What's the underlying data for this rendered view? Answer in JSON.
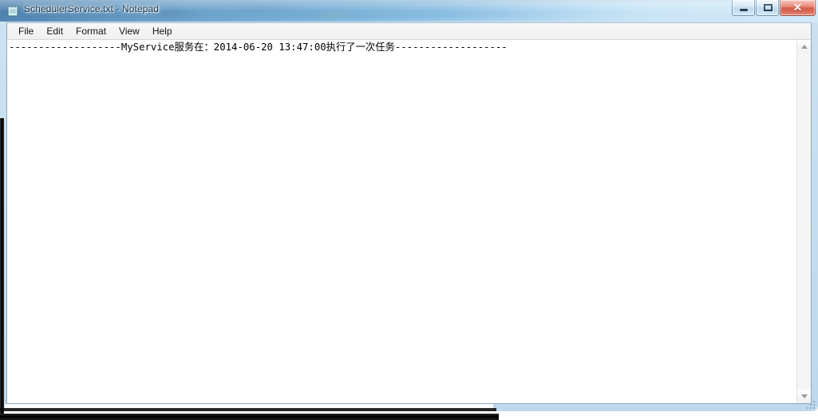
{
  "window": {
    "title": "SchedulerService.txt - Notepad",
    "icon": "notepad-icon",
    "controls": {
      "minimize_label": "–",
      "restore_label": "□",
      "close_label": "✕"
    }
  },
  "menubar": {
    "items": [
      {
        "label": "File"
      },
      {
        "label": "Edit"
      },
      {
        "label": "Format"
      },
      {
        "label": "View"
      },
      {
        "label": "Help"
      }
    ]
  },
  "document": {
    "filename": "SchedulerService.txt",
    "lines": [
      "-------------------MyService服务在：2014-06-20 13:47:00执行了一次任务-------------------"
    ],
    "text": "-------------------MyService服务在：2014-06-20 13:47:00执行了一次任务-------------------",
    "service_name": "MyService",
    "timestamp": "2014-06-20 13:47:00",
    "message": "执行了一次任务"
  },
  "scrollbar": {
    "up_arrow": "▲",
    "down_arrow": "▼"
  },
  "colors": {
    "titlebar_accent": "#5b8cb8",
    "close_button": "#cf4a34",
    "client_background": "#ffffff",
    "menubar_background": "#f0f0f0"
  }
}
